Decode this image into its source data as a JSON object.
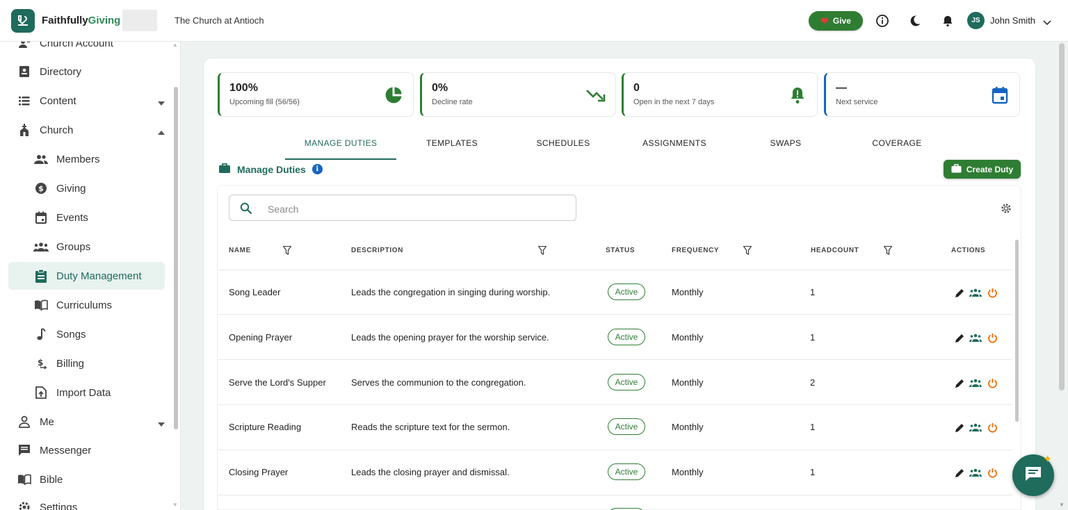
{
  "topbar": {
    "brand_main": "Faithfully",
    "brand_accent": "Giving",
    "church_name": "The Church at Antioch",
    "give_label": "Give",
    "user_initials": "JS",
    "user_name": "John Smith"
  },
  "sidebar": {
    "items": [
      {
        "label": "Church Account",
        "icon": "church-account-icon"
      },
      {
        "label": "Directory",
        "icon": "directory-icon"
      },
      {
        "label": "Content",
        "icon": "list-icon"
      },
      {
        "label": "Church",
        "icon": "church-icon"
      },
      {
        "label": "Members",
        "icon": "members-icon"
      },
      {
        "label": "Giving",
        "icon": "dollar-icon"
      },
      {
        "label": "Events",
        "icon": "calendar-icon"
      },
      {
        "label": "Groups",
        "icon": "groups-icon"
      },
      {
        "label": "Duty Management",
        "icon": "clipboard-icon"
      },
      {
        "label": "Curriculums",
        "icon": "book-icon"
      },
      {
        "label": "Songs",
        "icon": "music-note-icon"
      },
      {
        "label": "Billing",
        "icon": "billing-icon"
      },
      {
        "label": "Import Data",
        "icon": "import-icon"
      },
      {
        "label": "Me",
        "icon": "person-icon"
      },
      {
        "label": "Messenger",
        "icon": "message-icon"
      },
      {
        "label": "Bible",
        "icon": "bible-icon"
      },
      {
        "label": "Settings",
        "icon": "gear-icon"
      }
    ]
  },
  "stats": [
    {
      "value": "100%",
      "caption": "Upcoming fill (56/56)",
      "icon": "pie-chart-icon"
    },
    {
      "value": "0%",
      "caption": "Decline rate",
      "icon": "trending-down-icon"
    },
    {
      "value": "0",
      "caption": "Open in the next 7 days",
      "icon": "bell-alert-icon"
    },
    {
      "value": "—",
      "caption": "Next service",
      "icon": "calendar-icon"
    }
  ],
  "tabs": [
    "MANAGE DUTIES",
    "TEMPLATES",
    "SCHEDULES",
    "ASSIGNMENTS",
    "SWAPS",
    "COVERAGE"
  ],
  "section": {
    "title": "Manage Duties",
    "create_label": "Create Duty"
  },
  "search": {
    "placeholder": "Search"
  },
  "table": {
    "headers": {
      "name": "NAME",
      "description": "DESCRIPTION",
      "status": "STATUS",
      "frequency": "FREQUENCY",
      "headcount": "HEADCOUNT",
      "actions": "ACTIONS"
    },
    "rows": [
      {
        "name": "Song Leader",
        "description": "Leads the congregation in singing during worship.",
        "status": "Active",
        "frequency": "Monthly",
        "headcount": "1"
      },
      {
        "name": "Opening Prayer",
        "description": "Leads the opening prayer for the worship service.",
        "status": "Active",
        "frequency": "Monthly",
        "headcount": "1"
      },
      {
        "name": "Serve the Lord's Supper",
        "description": "Serves the communion to the congregation.",
        "status": "Active",
        "frequency": "Monthly",
        "headcount": "2"
      },
      {
        "name": "Scripture Reading",
        "description": "Reads the scripture text for the sermon.",
        "status": "Active",
        "frequency": "Monthly",
        "headcount": "1"
      },
      {
        "name": "Closing Prayer",
        "description": "Leads the closing prayer and dismissal.",
        "status": "Active",
        "frequency": "Monthly",
        "headcount": "1"
      }
    ]
  },
  "colors": {
    "brand": "#1f6b5c",
    "accent_green": "#2e7d32",
    "edit_icon": "#222222",
    "assign_icon": "#1f6b5c",
    "deactivate_icon": "#ef6c00"
  }
}
